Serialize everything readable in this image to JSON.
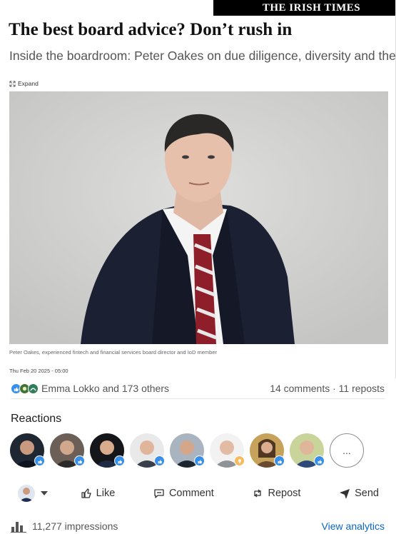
{
  "article": {
    "masthead": "THE IRISH TIMES",
    "headline": "The best board advice? Don’t rush in",
    "subheadline": "Inside the boardroom: Peter Oakes on due diligence, diversity and the p",
    "expand_label": "Expand",
    "caption": "Peter Oakes, experienced fintech and financial services board director and IoD member",
    "date": "Thu Feb 20 2025 - 05:00"
  },
  "social": {
    "reactors_text": "Emma Lokko and 173 others",
    "comments_reposts": "14 comments · 11 reposts",
    "reaction_icons": [
      "like-icon",
      "celebrate-icon",
      "insightful-icon"
    ]
  },
  "reactions": {
    "title": "Reactions",
    "more_label": "..."
  },
  "actions": {
    "like": "Like",
    "comment": "Comment",
    "repost": "Repost",
    "send": "Send"
  },
  "footer": {
    "impressions": "11,277 impressions",
    "analytics": "View analytics"
  },
  "colors": {
    "accent": "#0a66c2",
    "like_badge": "#378fe9",
    "idea_badge": "#f5bb5c"
  }
}
